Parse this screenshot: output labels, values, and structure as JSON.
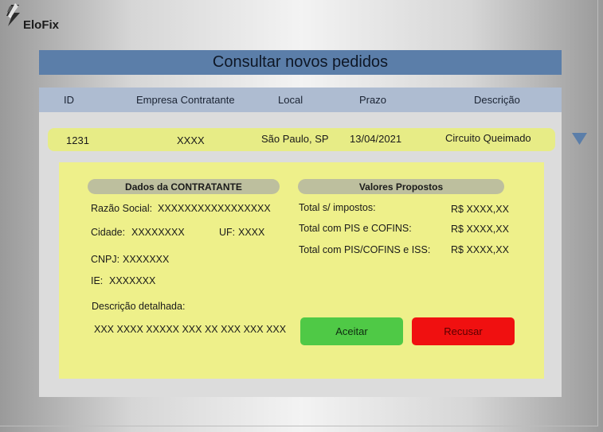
{
  "app": {
    "name": "EloFix"
  },
  "page": {
    "title": "Consultar novos pedidos"
  },
  "table": {
    "columns": [
      "ID",
      "Empresa Contratante",
      "Local",
      "Prazo",
      "Descrição"
    ],
    "rows": [
      {
        "id": "1231",
        "empresa": "XXXX",
        "local": "São Paulo, SP",
        "prazo": "13/04/2021",
        "descricao": "Circuito Queimado"
      }
    ]
  },
  "details": {
    "contratante": {
      "heading": "Dados da CONTRATANTE",
      "razao_social_label": "Razão Social:",
      "razao_social_value": "XXXXXXXXXXXXXXXXX",
      "cidade_label": "Cidade:",
      "cidade_value": "XXXXXXXX",
      "uf_label": "UF:",
      "uf_value": "XXXX",
      "cnpj_label": "CNPJ:",
      "cnpj_value": "XXXXXXX",
      "ie_label": "IE:",
      "ie_value": "XXXXXXX",
      "descricao_label": "Descrição detalhada:",
      "descricao_value": "XXX XXXX XXXXX XXX XX XXX XXX XXX"
    },
    "valores": {
      "heading": "Valores Propostos",
      "items": [
        {
          "label": "Total s/ impostos:",
          "value": "R$ XXXX,XX"
        },
        {
          "label": "Total com PIS e COFINS:",
          "value": "R$ XXXX,XX"
        },
        {
          "label": "Total com PIS/COFINS e ISS:",
          "value": "R$ XXXX,XX"
        }
      ]
    },
    "actions": {
      "accept": "Aceitar",
      "refuse": "Recusar"
    }
  },
  "colors": {
    "title_bar": "#5b7ea9",
    "header_row": "#aebcd1",
    "row_highlight": "#e7ec86",
    "detail_bg": "#eef08a",
    "accept": "#4fc946",
    "refuse": "#f01010",
    "toggle": "#5b7ea9"
  },
  "icons": {
    "logo": "lightning-bolt-icon",
    "expand": "triangle-down-icon"
  }
}
